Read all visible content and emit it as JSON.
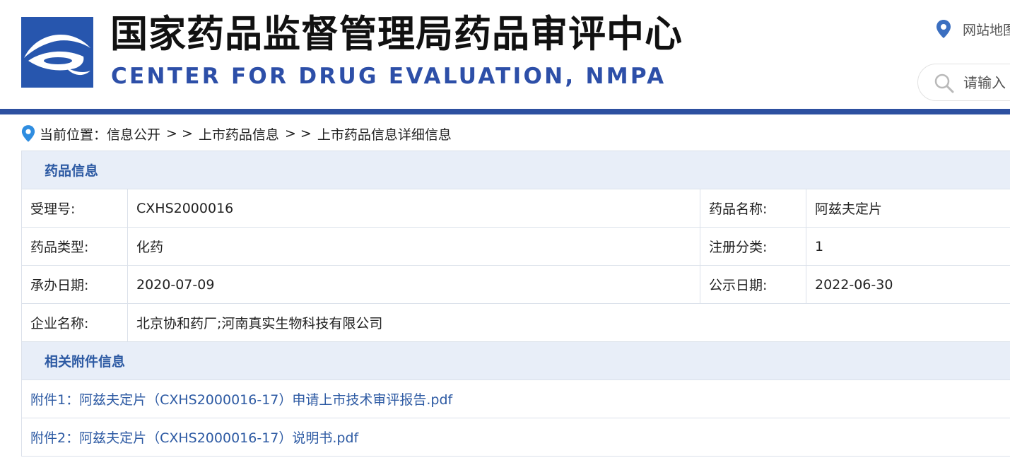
{
  "header": {
    "title_cn": "国家药品监督管理局药品审评中心",
    "title_en": "CENTER FOR DRUG EVALUATION, NMPA",
    "sitemap_label": "网站地图",
    "search_placeholder": "请输入",
    "brand_color": "#2756ae"
  },
  "breadcrumb": {
    "prefix": "当前位置：",
    "items": [
      "信息公开",
      "上市药品信息",
      "上市药品信息详细信息"
    ],
    "separator": "> >"
  },
  "drug_info": {
    "section_title": "药品信息",
    "acceptance_no": {
      "label": "受理号:",
      "value": "CXHS2000016"
    },
    "drug_name": {
      "label": "药品名称:",
      "value": "阿兹夫定片"
    },
    "drug_type": {
      "label": "药品类型:",
      "value": "化药"
    },
    "reg_class": {
      "label": "注册分类:",
      "value": "1"
    },
    "undertake_date": {
      "label": "承办日期:",
      "value": "2020-07-09"
    },
    "publish_date": {
      "label": "公示日期:",
      "value": "2022-06-30"
    },
    "company": {
      "label": "企业名称:",
      "value": "北京协和药厂;河南真实生物科技有限公司"
    }
  },
  "attachments": {
    "section_title": "相关附件信息",
    "items": [
      {
        "label": "附件1：阿兹夫定片（CXHS2000016-17）申请上市技术审评报告.pdf"
      },
      {
        "label": "附件2：阿兹夫定片（CXHS2000016-17）说明书.pdf"
      }
    ]
  }
}
